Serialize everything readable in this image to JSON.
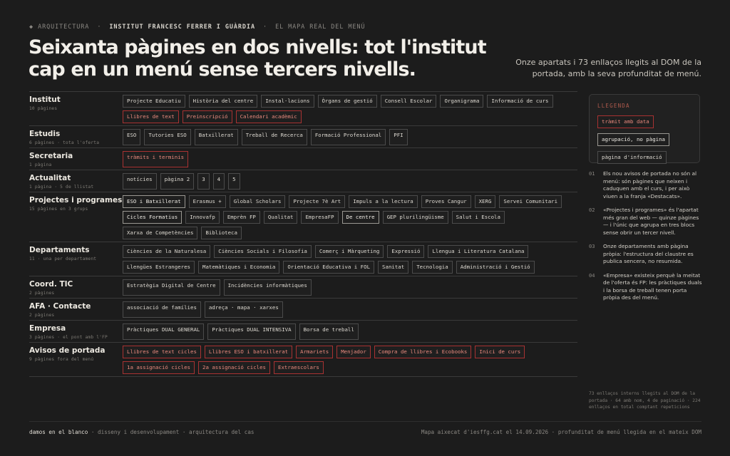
{
  "kicker": {
    "bullet": "◆",
    "part1": "ARQUITECTURA",
    "part2": "INSTITUT FRANCESC FERRER I GUÀRDIA",
    "part3": "EL MAPA REAL DEL MENÚ",
    "sep": "·"
  },
  "title": "Seixanta pàgines en dos nivells: tot l'institut cap en un menú sense tercers nivells.",
  "subtitle": "Onze apartats i 73 enllaços llegits al DOM de la portada, amb la seva profunditat de menú.",
  "rows": [
    {
      "label": "Institut",
      "meta": "10 pàgines",
      "tags": [
        {
          "text": "Projecte Educatiu",
          "kind": "info"
        },
        {
          "text": "Història del centre",
          "kind": "info"
        },
        {
          "text": "Instal·lacions",
          "kind": "info"
        },
        {
          "text": "Òrgans de gestió",
          "kind": "info"
        },
        {
          "text": "Consell Escolar",
          "kind": "info"
        },
        {
          "text": "Organigrama",
          "kind": "info"
        },
        {
          "text": "Informació de curs",
          "kind": "info"
        },
        {
          "text": "Llibres de text",
          "kind": "red"
        },
        {
          "text": "Preinscripció",
          "kind": "red"
        },
        {
          "text": "Calendari acadèmic",
          "kind": "red"
        }
      ]
    },
    {
      "label": "Estudis",
      "meta": "6 pàgines · tota l'oferta",
      "tags": [
        {
          "text": "ESO",
          "kind": "info"
        },
        {
          "text": "Tutories ESO",
          "kind": "info"
        },
        {
          "text": "Batxillerat",
          "kind": "info"
        },
        {
          "text": "Treball de Recerca",
          "kind": "info"
        },
        {
          "text": "Formació Professional",
          "kind": "info"
        },
        {
          "text": "PFI",
          "kind": "info"
        }
      ]
    },
    {
      "label": "Secretaria",
      "meta": "1 pàgina",
      "tags": [
        {
          "text": "tràmits i terminis",
          "kind": "red"
        }
      ]
    },
    {
      "label": "Actualitat",
      "meta": "1 pàgina · 5 de llistat",
      "tags": [
        {
          "text": "notícies",
          "kind": "info"
        },
        {
          "text": "pàgina 2",
          "kind": "info"
        },
        {
          "text": "3",
          "kind": "info"
        },
        {
          "text": "4",
          "kind": "info"
        },
        {
          "text": "5",
          "kind": "info"
        }
      ]
    },
    {
      "label": "Projectes i programes",
      "meta": "15 pàgines en 3 grups",
      "tags": [
        {
          "text": "ESO i Batxillerat",
          "kind": "group"
        },
        {
          "text": "Erasmus +",
          "kind": "info"
        },
        {
          "text": "Global Scholars",
          "kind": "info"
        },
        {
          "text": "Projecte 7è Art",
          "kind": "info"
        },
        {
          "text": "Impuls a la lectura",
          "kind": "info"
        },
        {
          "text": "Proves Cangur",
          "kind": "info"
        },
        {
          "text": "XERG",
          "kind": "info"
        },
        {
          "text": "Servei Comunitari",
          "kind": "info"
        },
        {
          "text": "Cicles Formatius",
          "kind": "group"
        },
        {
          "text": "Innovafp",
          "kind": "info"
        },
        {
          "text": "Emprèn FP",
          "kind": "info"
        },
        {
          "text": "Qualitat",
          "kind": "info"
        },
        {
          "text": "EmpresaFP",
          "kind": "info"
        },
        {
          "text": "De centre",
          "kind": "group"
        },
        {
          "text": "GEP plurilingüisme",
          "kind": "info"
        },
        {
          "text": "Salut i Escola",
          "kind": "info"
        },
        {
          "text": "Xarxa de Competències",
          "kind": "info"
        },
        {
          "text": "Biblioteca",
          "kind": "info"
        }
      ]
    },
    {
      "label": "Departaments",
      "meta": "11 · una per departament",
      "tags": [
        {
          "text": "Ciències de la Naturalesa",
          "kind": "info"
        },
        {
          "text": "Ciències Socials i Filosofia",
          "kind": "info"
        },
        {
          "text": "Comerç i Màrqueting",
          "kind": "info"
        },
        {
          "text": "Expressió",
          "kind": "info"
        },
        {
          "text": "Llengua i Literatura Catalana",
          "kind": "info"
        },
        {
          "text": "Llengües Estrangeres",
          "kind": "info"
        },
        {
          "text": "Matemàtiques i Economia",
          "kind": "info"
        },
        {
          "text": "Orientació Educativa i FOL",
          "kind": "info"
        },
        {
          "text": "Sanitat",
          "kind": "info"
        },
        {
          "text": "Tecnologia",
          "kind": "info"
        },
        {
          "text": "Administració i Gestió",
          "kind": "info"
        }
      ]
    },
    {
      "label": "Coord. TIC",
      "meta": "2 pàgines",
      "tags": [
        {
          "text": "Estratègia Digital de Centre",
          "kind": "info"
        },
        {
          "text": "Incidències informàtiques",
          "kind": "info"
        }
      ]
    },
    {
      "label": "AFA · Contacte",
      "meta": "2 pàgines",
      "tags": [
        {
          "text": "associació de famílies",
          "kind": "info"
        },
        {
          "text": "adreça · mapa · xarxes",
          "kind": "info"
        }
      ]
    },
    {
      "label": "Empresa",
      "meta": "3 pàgines · el pont amb l'FP",
      "tags": [
        {
          "text": "Pràctiques DUAL GENERAL",
          "kind": "info"
        },
        {
          "text": "Pràctiques DUAL INTENSIVA",
          "kind": "info"
        },
        {
          "text": "Borsa de treball",
          "kind": "info"
        }
      ]
    },
    {
      "label": "Avisos de portada",
      "meta": "9 pàgines fora del menú",
      "tags": [
        {
          "text": "Llibres de text cicles",
          "kind": "red"
        },
        {
          "text": "Llibres ESO i batxillerat",
          "kind": "red"
        },
        {
          "text": "Armariets",
          "kind": "red"
        },
        {
          "text": "Menjador",
          "kind": "red"
        },
        {
          "text": "Compra de llibres i Ecobooks",
          "kind": "red"
        },
        {
          "text": "Inici de curs",
          "kind": "red"
        },
        {
          "text": "1a assignació cicles",
          "kind": "red"
        },
        {
          "text": "2a assignació cicles",
          "kind": "red"
        },
        {
          "text": "Extraescolars",
          "kind": "red"
        }
      ]
    }
  ],
  "legend": {
    "title": "LLEGENDA",
    "items": [
      {
        "text": "tràmit amb data",
        "kind": "red"
      },
      {
        "text": "agrupació, no pàgina",
        "kind": "group"
      },
      {
        "text": "pàgina d'informació",
        "kind": "info"
      }
    ]
  },
  "notes": [
    {
      "num": "01",
      "text": "Els nou avisos de portada no són al menú: són pàgines que neixen i caduquen amb el curs, i per això viuen a la franja «Destacats»."
    },
    {
      "num": "02",
      "text": "«Projectes i programes» és l'apartat més gran del web — quinze pàgines— i l'únic que agrupa en tres blocs sense obrir un tercer nivell."
    },
    {
      "num": "03",
      "text": "Onze departaments amb pàgina pròpia: l'estructura del claustre es publica sencera, no resumida."
    },
    {
      "num": "04",
      "text": "«Empresa» existeix perquè la meitat de l'oferta és FP: les pràctiques duals i la borsa de treball tenen porta pròpia des del menú."
    }
  ],
  "footnote": "73 enllaços interns llegits al DOM de la portada · 64 amb nom, 4 de paginació · 224 enllaços en total comptant repeticions",
  "footer": {
    "brand": "damos en el blanco",
    "tagline": "· disseny i desenvolupament · arquitectura del cas",
    "right": "Mapa aixecat d'iesffg.cat el 14.09.2026 · profunditat de menú llegida en el mateix DOM"
  }
}
